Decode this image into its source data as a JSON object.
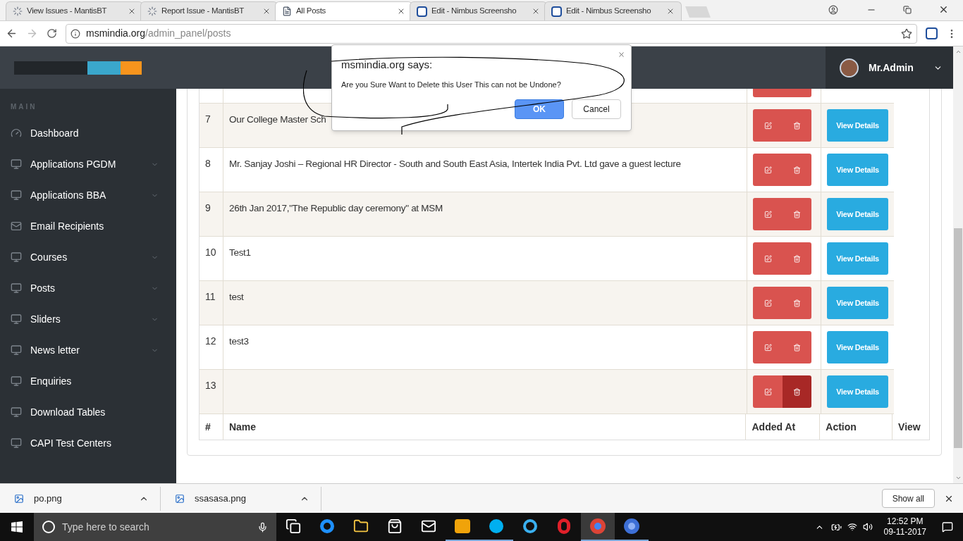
{
  "browser": {
    "tabs": [
      {
        "title": "View Issues - MantisBT",
        "kind": "loading",
        "selected": false
      },
      {
        "title": "Report Issue - MantisBT",
        "kind": "loading",
        "selected": false
      },
      {
        "title": "All Posts",
        "kind": "page",
        "selected": true
      },
      {
        "title": "Edit - Nimbus Screensho",
        "kind": "extension",
        "selected": false
      },
      {
        "title": "Edit - Nimbus Screensho",
        "kind": "extension",
        "selected": false
      }
    ],
    "address": {
      "host": "msmindia.org",
      "path": "/admin_panel/posts"
    }
  },
  "header": {
    "user": "Mr.Admin"
  },
  "sidebar": {
    "heading": "MAIN",
    "items": [
      {
        "label": "Dashboard",
        "kind": "dashboard",
        "has_submenu": false
      },
      {
        "label": "Applications PGDM",
        "kind": "monitor",
        "has_submenu": true
      },
      {
        "label": "Applications BBA",
        "kind": "monitor",
        "has_submenu": true
      },
      {
        "label": "Email Recipients",
        "kind": "mail",
        "has_submenu": false
      },
      {
        "label": "Courses",
        "kind": "monitor",
        "has_submenu": true
      },
      {
        "label": "Posts",
        "kind": "monitor",
        "has_submenu": true
      },
      {
        "label": "Sliders",
        "kind": "monitor",
        "has_submenu": true
      },
      {
        "label": "News letter",
        "kind": "monitor",
        "has_submenu": true
      },
      {
        "label": "Enquiries",
        "kind": "monitor",
        "has_submenu": false
      },
      {
        "label": "Download Tables",
        "kind": "monitor",
        "has_submenu": false
      },
      {
        "label": "CAPI Test Centers",
        "kind": "monitor",
        "has_submenu": false
      }
    ]
  },
  "table": {
    "rows": [
      {
        "delete_hovered": false
      },
      {
        "number": "7",
        "name": "Our College Master Sch",
        "action": "View Details",
        "delete_hovered": false
      },
      {
        "number": "8",
        "name": "Mr. Sanjay Joshi – Regional HR Director - South and South East Asia, Intertek India Pvt. Ltd gave a guest lecture",
        "action": "View Details",
        "delete_hovered": false
      },
      {
        "number": "9",
        "name": "26th Jan 2017,\"The Republic day ceremony\" at MSM",
        "action": "View Details",
        "delete_hovered": false
      },
      {
        "number": "10",
        "name": "Test1",
        "action": "View Details",
        "delete_hovered": false
      },
      {
        "number": "11",
        "name": "test",
        "action": "View Details",
        "delete_hovered": false
      },
      {
        "number": "12",
        "name": "test3",
        "action": "View Details",
        "delete_hovered": false
      },
      {
        "number": "13",
        "action": "View Details",
        "delete_hovered": true
      }
    ],
    "footer": [
      "#",
      "Name",
      "Added At",
      "Action",
      "View"
    ]
  },
  "dialog": {
    "title": "msmindia.org says:",
    "message": "Are you Sure Want to Delete this User This can not be Undone?",
    "ok": "OK",
    "cancel": "Cancel"
  },
  "downloads": {
    "items": [
      "po.png",
      "ssasasa.png"
    ],
    "show_all": "Show all"
  },
  "taskbar": {
    "search_placeholder": "Type here to search",
    "apps": [
      {
        "kind": "task-view",
        "running": false,
        "selected": false
      },
      {
        "kind": "edge",
        "running": false,
        "selected": false
      },
      {
        "kind": "folder",
        "running": false,
        "selected": false
      },
      {
        "kind": "store",
        "running": false,
        "selected": false
      },
      {
        "kind": "mail",
        "running": false,
        "selected": false
      },
      {
        "kind": "outlook",
        "running": true,
        "selected": false
      },
      {
        "kind": "skype",
        "running": true,
        "selected": false
      },
      {
        "kind": "ie",
        "running": false,
        "selected": false
      },
      {
        "kind": "opera",
        "running": false,
        "selected": false
      },
      {
        "kind": "chrome",
        "running": true,
        "selected": true
      },
      {
        "kind": "chrome-blue",
        "running": true,
        "selected": false
      }
    ],
    "time": "12:52 PM",
    "date": "09-11-2017"
  }
}
